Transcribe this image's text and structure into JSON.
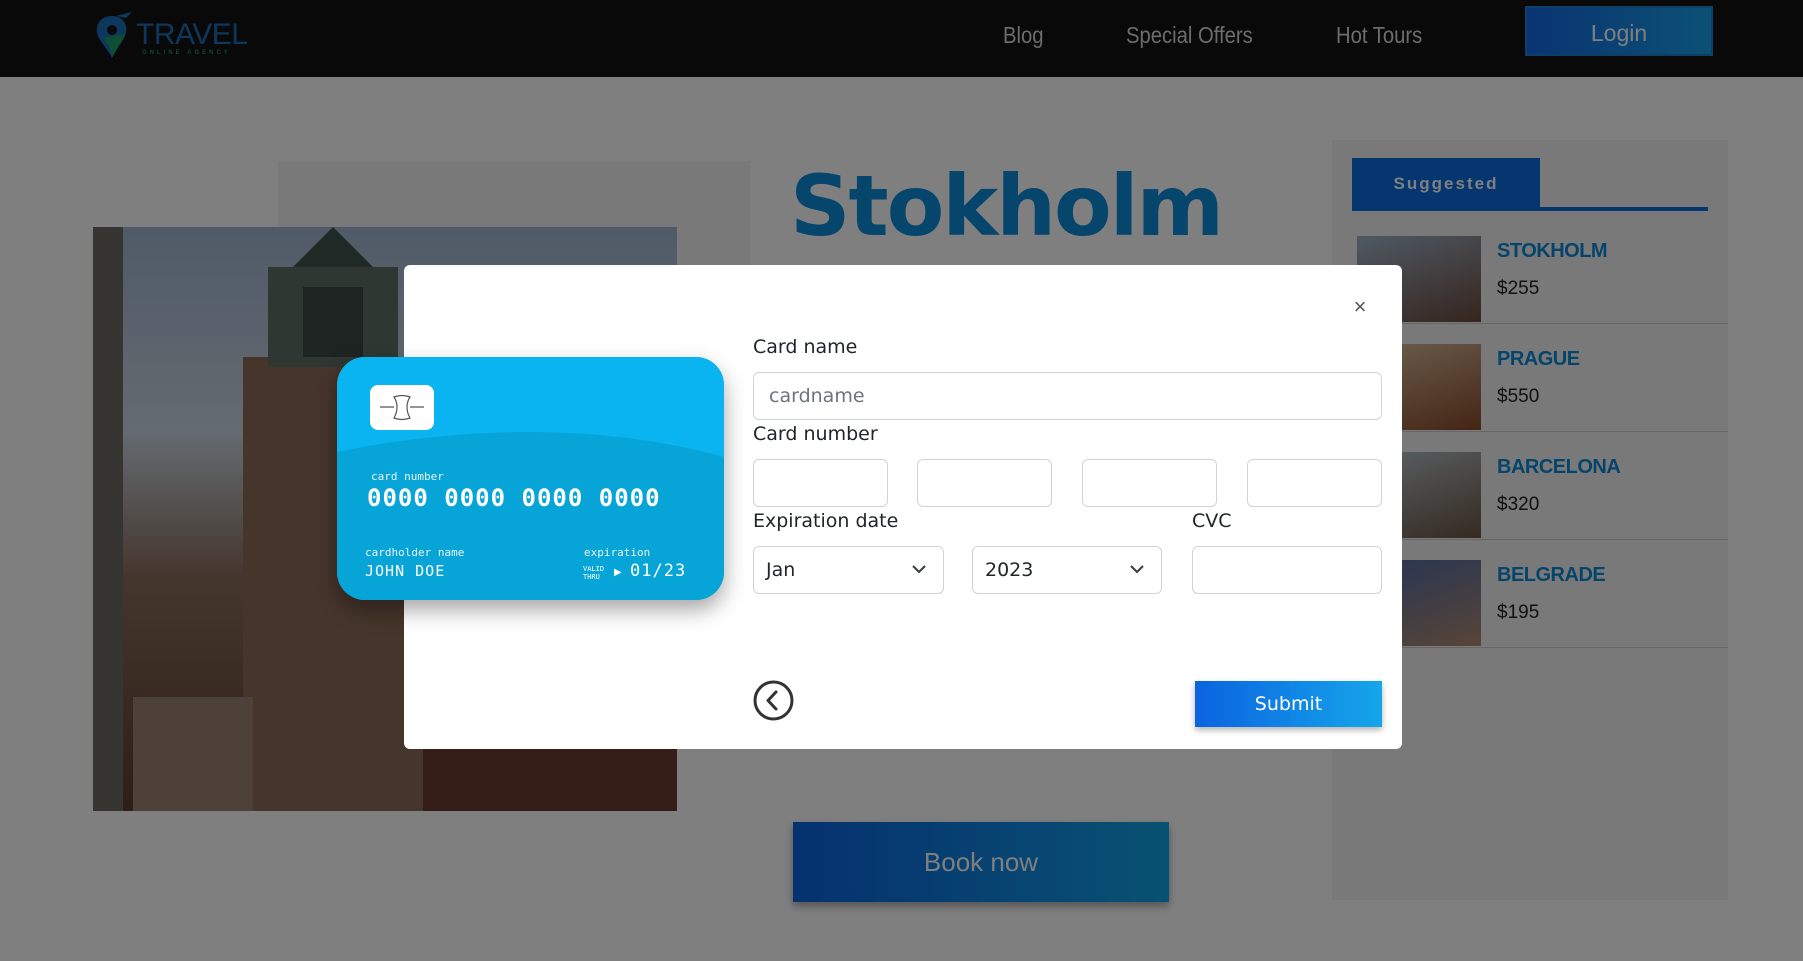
{
  "header": {
    "logo_text": "TRAVEL",
    "logo_subtext": "ONLINE AGENCY",
    "nav": [
      {
        "label": "Blog"
      },
      {
        "label": "Special Offers"
      },
      {
        "label": "Hot Tours"
      }
    ],
    "login_label": "Login"
  },
  "main": {
    "city_title": "Stokholm",
    "book_label": "Book now"
  },
  "sidebar": {
    "tab_label": "Suggested",
    "items": [
      {
        "name": "STOKHOLM",
        "price": "$255"
      },
      {
        "name": "PRAGUE",
        "price": "$550"
      },
      {
        "name": "BARCELONA",
        "price": "$320"
      },
      {
        "name": "BELGRADE",
        "price": "$195"
      }
    ]
  },
  "modal": {
    "close_label": "×",
    "card_preview": {
      "number_label": "card number",
      "number": "0000 0000 0000 0000",
      "holder_label": "cardholder name",
      "holder": "JOHN DOE",
      "expiration_label": "expiration",
      "valid_label_1": "VALID",
      "valid_label_2": "THRU",
      "expiration": "01/23"
    },
    "card_name_label": "Card name",
    "card_name_placeholder": "cardname",
    "card_number_label": "Card number",
    "expiration_label": "Expiration date",
    "month_value": "Jan",
    "year_value": "2023",
    "cvc_label": "CVC",
    "submit_label": "Submit"
  },
  "colors": {
    "accent": "#0b6ce0",
    "title_blue": "#0d8bd9",
    "card_blue": "#0ab4f0",
    "header_bg": "#121212"
  }
}
